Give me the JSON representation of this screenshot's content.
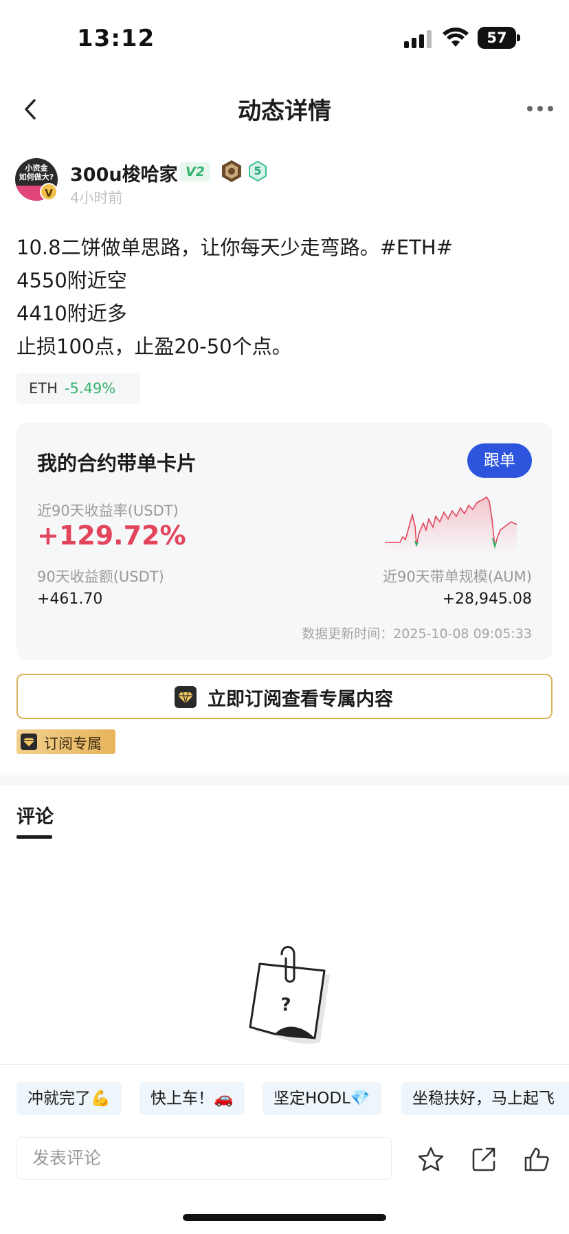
{
  "status_bar": {
    "time": "13:12",
    "battery": "57",
    "icons": [
      "signal-icon",
      "wifi-icon",
      "battery-icon"
    ]
  },
  "nav": {
    "title": "动态详情",
    "icons": [
      "back-icon",
      "more-icon"
    ]
  },
  "author": {
    "avatar_text": "小资金\n如何做大?",
    "avatar_badge": "V",
    "name": "300u梭哈家",
    "vip": "V2",
    "level": "5",
    "time": "4小时前"
  },
  "post": {
    "lines": [
      "10.8二饼做单思路，让你每天少走弯路。#ETH#",
      "4550附近空",
      "4410附近多",
      "止损100点，止盈20-50个点。"
    ],
    "ticker": {
      "symbol": "ETH",
      "change": "-5.49%"
    }
  },
  "card": {
    "title": "我的合约带单卡片",
    "follow_label": "跟单",
    "roi_label": "近90天收益率(USDT)",
    "roi_value": "+129.72%",
    "pnl_label": "90天收益额(USDT)",
    "pnl_value": "+461.70",
    "aum_label": "近90天带单规模(AUM)",
    "aum_value": "+28,945.08",
    "update_time": "数据更新时间：2025-10-08 09:05:33",
    "colors": {
      "line": "#e2455c",
      "dip": "#34b26b",
      "follow_button": "#2c54dc"
    }
  },
  "subscribe": {
    "button_label": "立即订阅查看专属内容",
    "tag_label": "订阅专属",
    "icon": "diamond-icon"
  },
  "comments": {
    "tab_label": "评论",
    "empty_icon": "empty-paper-icon",
    "quick_replies": [
      "冲就完了💪",
      "快上车！🚗",
      "坚定HODL💎",
      "坐稳扶好，马上起飞"
    ],
    "input_placeholder": "发表评论",
    "actions": [
      "star-icon",
      "share-icon",
      "like-icon"
    ]
  }
}
